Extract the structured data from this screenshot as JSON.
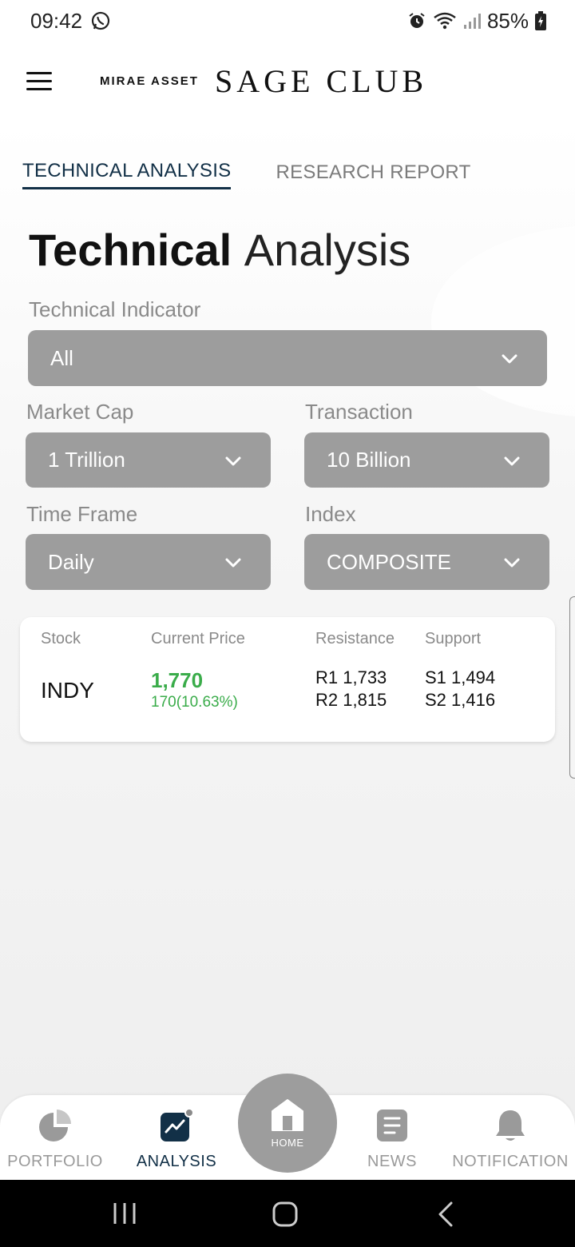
{
  "status_bar": {
    "time": "09:42",
    "battery": "85%"
  },
  "header": {
    "brand_small": "MIRAE ASSET",
    "brand_big": "SAGE CLUB"
  },
  "tabs": [
    {
      "label": "TECHNICAL ANALYSIS",
      "active": true
    },
    {
      "label": "RESEARCH REPORT",
      "active": false
    }
  ],
  "page_title": {
    "bold": "Technical",
    "light": "Analysis"
  },
  "filters": {
    "technical_indicator": {
      "label": "Technical Indicator",
      "value": "All"
    },
    "market_cap": {
      "label": "Market Cap",
      "value": "1 Trillion"
    },
    "transaction": {
      "label": "Transaction",
      "value": "10 Billion"
    },
    "time_frame": {
      "label": "Time Frame",
      "value": "Daily"
    },
    "index": {
      "label": "Index",
      "value": "COMPOSITE"
    }
  },
  "table": {
    "headers": {
      "stock": "Stock",
      "current_price": "Current Price",
      "resistance": "Resistance",
      "support": "Support"
    },
    "rows": [
      {
        "stock": "INDY",
        "price": "1,770",
        "change": "170(10.63%)",
        "r1": "R1 1,733",
        "r2": "R2 1,815",
        "s1": "S1 1,494",
        "s2": "S2 1,416"
      }
    ]
  },
  "bottom_nav": {
    "portfolio": "PORTFOLIO",
    "analysis": "ANALYSIS",
    "home": "HOME",
    "news": "NEWS",
    "notification": "NOTIFICATION"
  },
  "colors": {
    "accent": "#123047",
    "select_bg": "#9d9d9d",
    "positive": "#3aac4a"
  }
}
